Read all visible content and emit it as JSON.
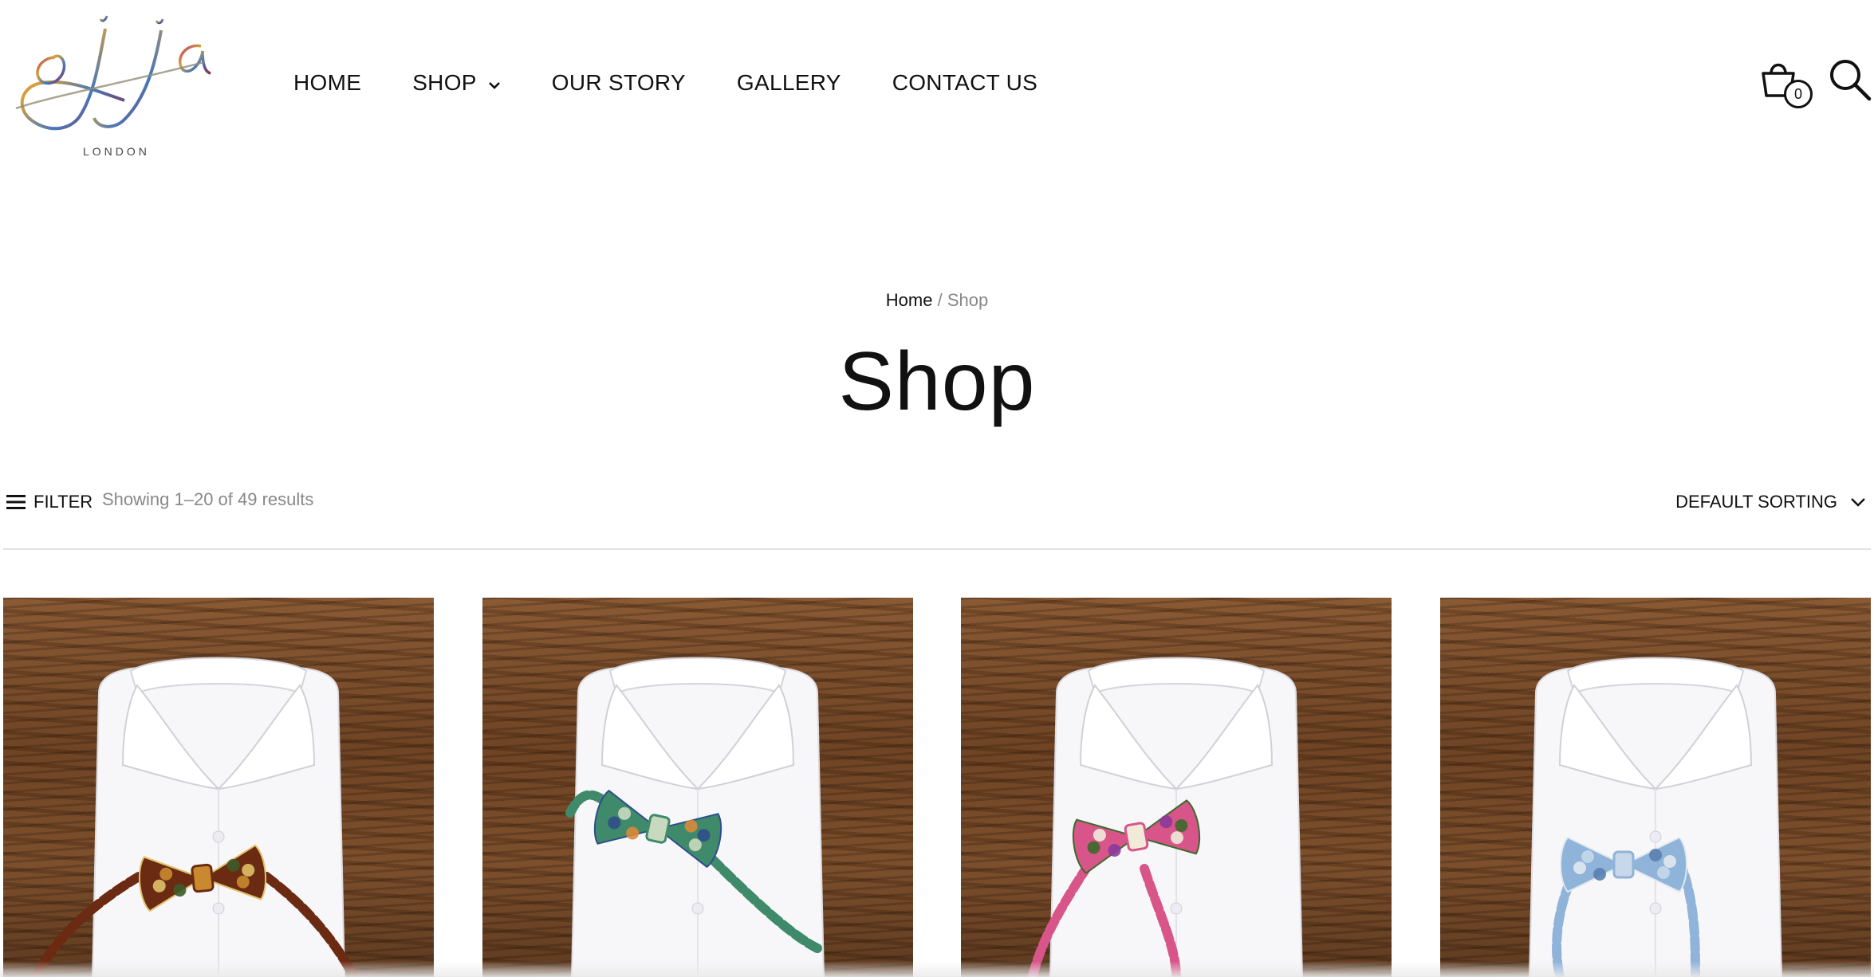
{
  "brand": {
    "logo_text": "joja",
    "logo_sub": "LONDON"
  },
  "nav": {
    "items": [
      {
        "label": "HOME"
      },
      {
        "label": "SHOP",
        "has_dropdown": true
      },
      {
        "label": "OUR STORY"
      },
      {
        "label": "GALLERY"
      },
      {
        "label": "CONTACT US"
      }
    ]
  },
  "header": {
    "cart_icon": "shopping-bag-icon",
    "cart_count": "0",
    "search_icon": "search-icon"
  },
  "breadcrumb": {
    "home": "Home",
    "separator": "/",
    "current": "Shop"
  },
  "page": {
    "title": "Shop"
  },
  "toolbar": {
    "filter_label": "FILTER",
    "filter_icon": "menu-lines-icon",
    "results_text": "Showing 1–20 of 49 results",
    "sorting_label": "DEFAULT SORTING",
    "sorting_icon": "chevron-down-icon"
  },
  "products": [
    {
      "image": "white shirt with paisley bow tie",
      "tie_colors": [
        "#6b2a12",
        "#c9892f",
        "#3f5a2a",
        "#e0c068"
      ]
    },
    {
      "image": "white shirt with green geometric bow tie",
      "tie_colors": [
        "#3f8a6a",
        "#c9d9c0",
        "#d98a3a",
        "#2f4e8a"
      ]
    },
    {
      "image": "white shirt with pink floral bow tie",
      "tie_colors": [
        "#d8558a",
        "#f1ead8",
        "#8a3a9a",
        "#3c6a2a"
      ]
    },
    {
      "image": "white shirt with blue floral bow tie",
      "tie_colors": [
        "#8fb3d9",
        "#c6d8ea",
        "#5a7fb0",
        "#e0e8f0"
      ]
    }
  ],
  "colors": {
    "text": "#111111",
    "muted": "#888888",
    "divider": "#e2e2e2",
    "wood": "#7a4c2a"
  }
}
